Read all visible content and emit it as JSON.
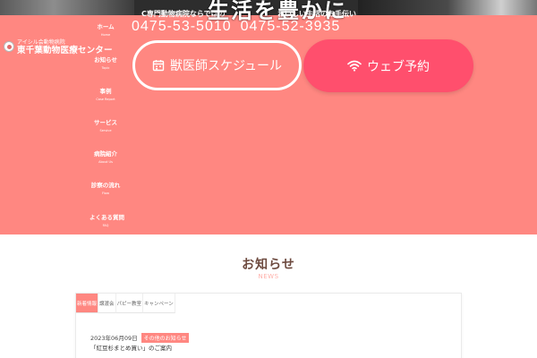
{
  "header": {
    "tagline": "生活を豊かに",
    "tagline_small_left": "C専門動物病院ならではの",
    "tagline_small_right": "おいしい生活のお手伝い",
    "logo_sub": "アイシル会動物病院",
    "logo_name": "東千葉動物医療センター",
    "phone_1": "0475-53-5010",
    "phone_2": "0475-52-3935"
  },
  "nav": {
    "items": [
      {
        "jp": "ホーム",
        "en": "Home"
      },
      {
        "jp": "お知らせ",
        "en": "Topic"
      },
      {
        "jp": "事例",
        "en": "Case Report"
      },
      {
        "jp": "サービス",
        "en": "Service"
      },
      {
        "jp": "病院紹介",
        "en": "About Us"
      },
      {
        "jp": "診察の流れ",
        "en": "Flow"
      },
      {
        "jp": "よくある質問",
        "en": "FAQ"
      }
    ]
  },
  "cta": {
    "schedule_label": "獣医師スケジュール",
    "web_label": "ウェブ予約",
    "schedule_icon": "calendar-icon",
    "web_icon": "wifi-icon"
  },
  "news": {
    "title": "お知らせ",
    "subtitle": "NEWS",
    "tabs": [
      "新着情報",
      "譲渡会",
      "パピー教室",
      "キャンペーン"
    ],
    "items": [
      {
        "date": "2023年06月09日",
        "category": "その他のお知らせ",
        "title": "「紅豆杉まとめ買い」のご案内"
      }
    ]
  },
  "colors": {
    "hero_bg": "#ff8781",
    "accent": "#ff4f6d",
    "news_title": "#6d4a3f"
  }
}
